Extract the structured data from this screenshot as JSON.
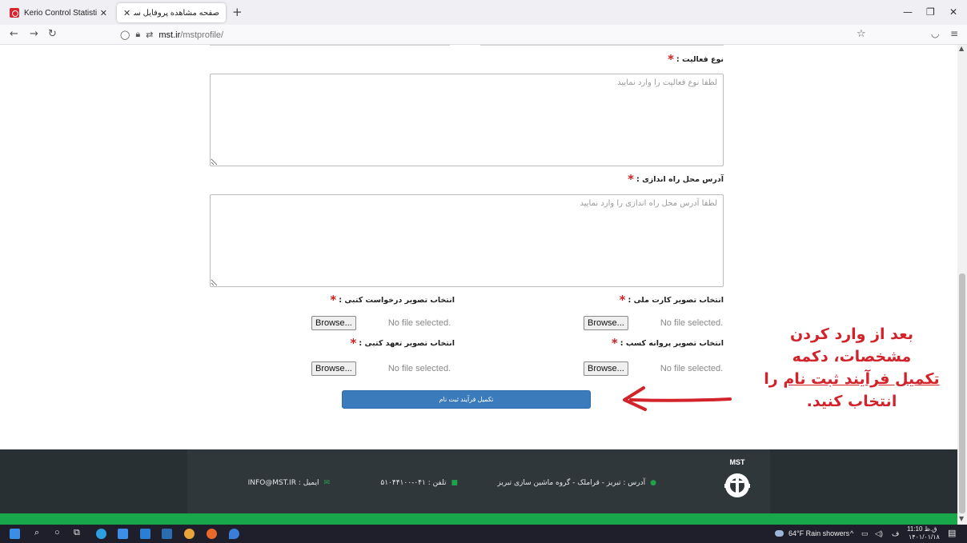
{
  "browser": {
    "tabs": [
      {
        "title": "Kerio Control Statistics",
        "active": false
      },
      {
        "title": "صفحه مشاهده پروفایل سامانه فروش",
        "active": true
      }
    ],
    "new_tab": "+",
    "url_host": "mst.ir",
    "url_path": "/mstprofile/"
  },
  "form": {
    "activity": {
      "label": "نوع فعالیت :",
      "placeholder": "لطفا نوع فعالیت را وارد نمایید"
    },
    "address": {
      "label": "آدرس محل راه اندازی :",
      "placeholder": "لطفا آدرس محل راه اندازی را وارد نمایید"
    },
    "files": [
      {
        "label": "انتخاب تصویر کارت ملی :",
        "button": "Browse...",
        "status": "No file selected."
      },
      {
        "label": "انتخاب تصویر درخواست کتبی :",
        "button": "Browse...",
        "status": "No file selected."
      },
      {
        "label": "انتخاب تصویر پروانه کسب :",
        "button": "Browse...",
        "status": "No file selected."
      },
      {
        "label": "انتخاب تصویر تعهد کتبی :",
        "button": "Browse...",
        "status": "No file selected."
      }
    ],
    "required_mark": "*",
    "submit_label": "تکمیل فرآیند ثبت نام"
  },
  "annotation": {
    "line1": "بعد از وارد کردن",
    "line2": "مشخصات، دکمه",
    "line3": "تکمیل فرآیند ثبت نام",
    "line3_tail": " را",
    "line4": "انتخاب کنید.",
    "color": "#d2232a"
  },
  "footer": {
    "logo_text": "MST",
    "address": "آدرس : تبریز - قراملک - گروه ماشین سازی تبریز",
    "phone": "تلفن : ۰۴۱-۵۱۰۴۴۱۰۰",
    "email": "ایمیل : INFO@MST.IR"
  },
  "taskbar": {
    "weather": "64°F  Rain showers",
    "time": "11:10 ق.ظ",
    "date": "۱۴۰۱/۰۱/۱۸"
  }
}
